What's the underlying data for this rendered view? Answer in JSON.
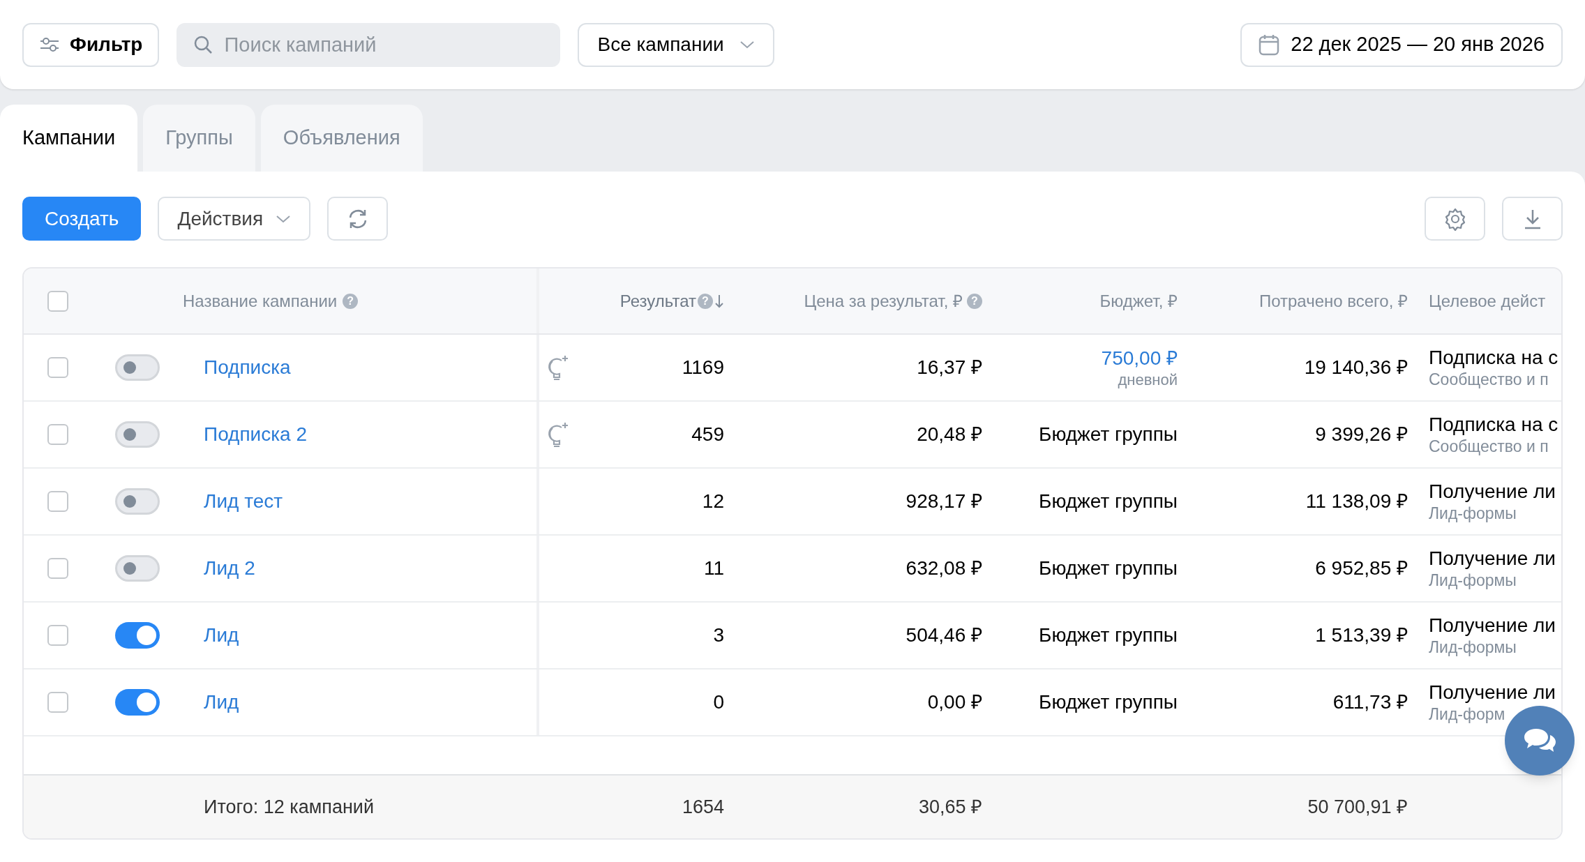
{
  "filter_button": {
    "label": "Фильтр"
  },
  "search": {
    "placeholder": "Поиск кампаний"
  },
  "campaign_select": {
    "value": "Все кампании"
  },
  "date_range": {
    "label": "22 дек 2025 — 20 янв 2026"
  },
  "tabs": [
    {
      "label": "Кампании",
      "selected": true
    },
    {
      "label": "Группы",
      "selected": false
    },
    {
      "label": "Объявления",
      "selected": false
    }
  ],
  "toolbar": {
    "create": "Создать",
    "actions": "Действия"
  },
  "table": {
    "select_all": {
      "checked": false
    },
    "columns": [
      {
        "label": "Название кампании",
        "help": "?",
        "sorted": false
      },
      {
        "label": "Результат",
        "help": "?",
        "sorted": true
      },
      {
        "label": "Цена за результат, ₽",
        "help": "?",
        "sorted": false
      },
      {
        "label": "Бюджет, ₽",
        "sorted": false
      },
      {
        "label": "Потрачено всего, ₽",
        "sorted": false
      },
      {
        "label": "Целевое дейст",
        "sorted": false
      }
    ],
    "rows": [
      {
        "checked": false,
        "on": false,
        "name": "Подписка",
        "hint": true,
        "result": "1169",
        "price": "16,37 ₽",
        "budget": {
          "kind": "daily",
          "text": "750,00 ₽",
          "note": "дневной"
        },
        "spent": "19 140,36 ₽",
        "goal": "Подписка на с",
        "goal_note": "Сообщество и п"
      },
      {
        "checked": false,
        "on": false,
        "name": "Подписка 2",
        "hint": true,
        "result": "459",
        "price": "20,48 ₽",
        "budget": {
          "kind": "group",
          "text": "Бюджет группы"
        },
        "spent": "9 399,26 ₽",
        "goal": "Подписка на с",
        "goal_note": "Сообщество и п"
      },
      {
        "checked": false,
        "on": false,
        "name": "Лид тест",
        "hint": false,
        "result": "12",
        "price": "928,17 ₽",
        "budget": {
          "kind": "group",
          "text": "Бюджет группы"
        },
        "spent": "11 138,09 ₽",
        "goal": "Получение ли",
        "goal_note": "Лид-формы"
      },
      {
        "checked": false,
        "on": false,
        "name": "Лид 2",
        "hint": false,
        "result": "11",
        "price": "632,08 ₽",
        "budget": {
          "kind": "group",
          "text": "Бюджет группы"
        },
        "spent": "6 952,85 ₽",
        "goal": "Получение ли",
        "goal_note": "Лид-формы"
      },
      {
        "checked": false,
        "on": true,
        "name": "Лид",
        "hint": false,
        "result": "3",
        "price": "504,46 ₽",
        "budget": {
          "kind": "group",
          "text": "Бюджет группы"
        },
        "spent": "1 513,39 ₽",
        "goal": "Получение ли",
        "goal_note": "Лид-формы"
      },
      {
        "checked": false,
        "on": true,
        "name": "Лид",
        "hint": false,
        "result": "0",
        "price": "0,00 ₽",
        "budget": {
          "kind": "group",
          "text": "Бюджет группы"
        },
        "spent": "611,73 ₽",
        "goal": "Получение ли",
        "goal_note": "Лид-форм"
      }
    ],
    "footer": {
      "label": "Итого: 12 кампаний",
      "result": "1654",
      "price": "30,65 ₽",
      "spent": "50 700,91 ₽"
    }
  }
}
